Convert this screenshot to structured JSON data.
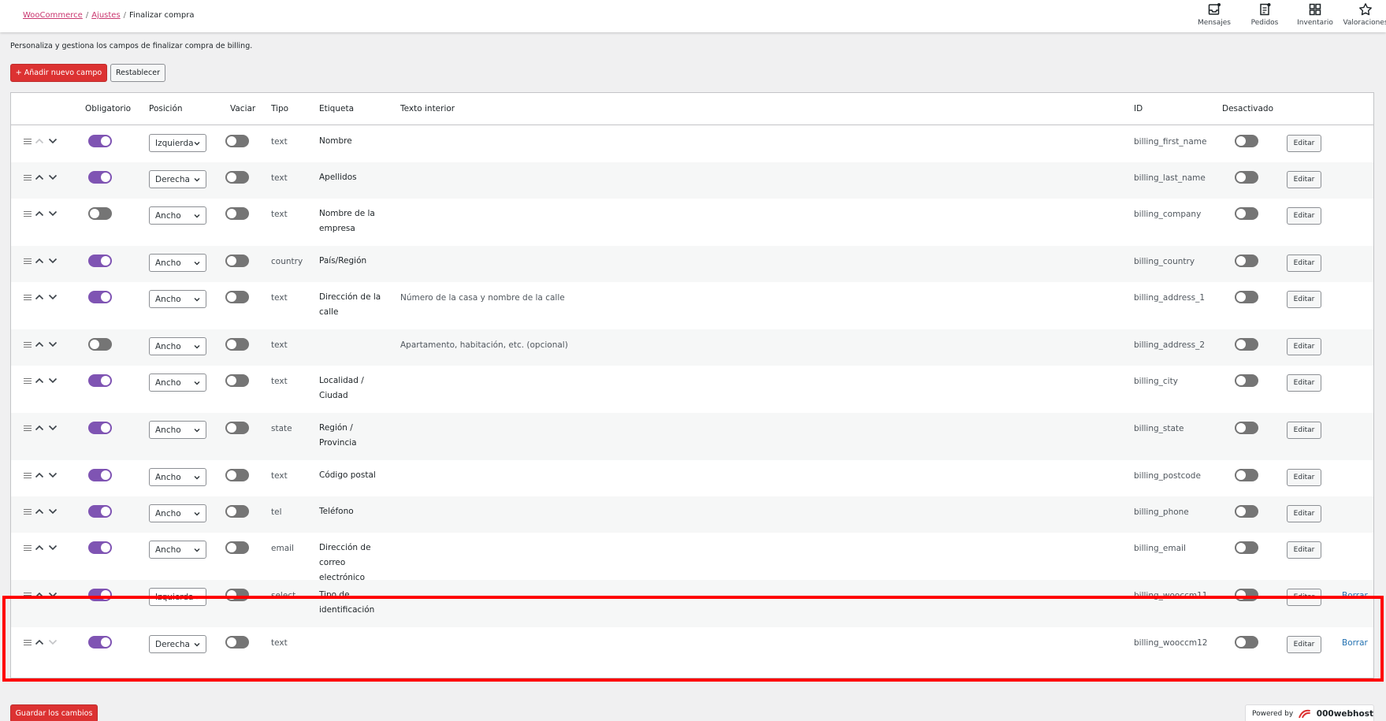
{
  "breadcrumb": {
    "items": [
      "WooCommerce",
      "Ajustes",
      "Finalizar compra"
    ],
    "separator": "/"
  },
  "activity": [
    {
      "label": "Mensajes",
      "icon": "inbox-icon"
    },
    {
      "label": "Pedidos",
      "icon": "orders-icon"
    },
    {
      "label": "Inventario",
      "icon": "inventory-icon"
    },
    {
      "label": "Valoraciones",
      "icon": "star-icon"
    }
  ],
  "description": "Personaliza y gestiona los campos de finalizar compra de billing.",
  "buttons": {
    "add_field": "+ Añadir nuevo campo",
    "reset": "Restablecer",
    "save": "Guardar los cambios"
  },
  "headers": {
    "required": "Obligatorio",
    "position": "Posición",
    "clear": "Vaciar",
    "type": "Tipo",
    "label": "Etiqueta",
    "placeholder": "Texto interior",
    "id": "ID",
    "disabled": "Desactivado"
  },
  "actions": {
    "edit": "Editar",
    "delete": "Borrar"
  },
  "rows": [
    {
      "required": true,
      "position": "Izquierda",
      "clear": false,
      "type": "text",
      "label": "Nombre",
      "placeholder": "",
      "id": "billing_first_name",
      "disabled": false,
      "deletable": false,
      "up": false,
      "down": true
    },
    {
      "required": true,
      "position": "Derecha",
      "clear": false,
      "type": "text",
      "label": "Apellidos",
      "placeholder": "",
      "id": "billing_last_name",
      "disabled": false,
      "deletable": false,
      "up": true,
      "down": true
    },
    {
      "required": false,
      "position": "Ancho",
      "clear": false,
      "type": "text",
      "label": "Nombre de la empresa",
      "placeholder": "",
      "id": "billing_company",
      "disabled": false,
      "deletable": false,
      "up": true,
      "down": true
    },
    {
      "required": true,
      "position": "Ancho",
      "clear": false,
      "type": "country",
      "label": "País/Región",
      "placeholder": "",
      "id": "billing_country",
      "disabled": false,
      "deletable": false,
      "up": true,
      "down": true
    },
    {
      "required": true,
      "position": "Ancho",
      "clear": false,
      "type": "text",
      "label": "Dirección de la calle",
      "placeholder": "Número de la casa y nombre de la calle",
      "id": "billing_address_1",
      "disabled": false,
      "deletable": false,
      "up": true,
      "down": true
    },
    {
      "required": false,
      "position": "Ancho",
      "clear": false,
      "type": "text",
      "label": "",
      "placeholder": "Apartamento, habitación, etc. (opcional)",
      "id": "billing_address_2",
      "disabled": false,
      "deletable": false,
      "up": true,
      "down": true
    },
    {
      "required": true,
      "position": "Ancho",
      "clear": false,
      "type": "text",
      "label": "Localidad / Ciudad",
      "placeholder": "",
      "id": "billing_city",
      "disabled": false,
      "deletable": false,
      "up": true,
      "down": true
    },
    {
      "required": true,
      "position": "Ancho",
      "clear": false,
      "type": "state",
      "label": "Región / Provincia",
      "placeholder": "",
      "id": "billing_state",
      "disabled": false,
      "deletable": false,
      "up": true,
      "down": true
    },
    {
      "required": true,
      "position": "Ancho",
      "clear": false,
      "type": "text",
      "label": "Código postal",
      "placeholder": "",
      "id": "billing_postcode",
      "disabled": false,
      "deletable": false,
      "up": true,
      "down": true
    },
    {
      "required": true,
      "position": "Ancho",
      "clear": false,
      "type": "tel",
      "label": "Teléfono",
      "placeholder": "",
      "id": "billing_phone",
      "disabled": false,
      "deletable": false,
      "up": true,
      "down": true
    },
    {
      "required": true,
      "position": "Ancho",
      "clear": false,
      "type": "email",
      "label": "Dirección de correo electrónico",
      "placeholder": "",
      "id": "billing_email",
      "disabled": false,
      "deletable": false,
      "up": true,
      "down": true
    },
    {
      "required": true,
      "position": "Izquierda",
      "clear": false,
      "type": "select",
      "label": "Tipo de identificación",
      "placeholder": "",
      "id": "billing_wooccm11",
      "disabled": false,
      "deletable": true,
      "up": true,
      "down": true
    },
    {
      "required": true,
      "position": "Derecha",
      "clear": false,
      "type": "text",
      "label": "",
      "placeholder": "",
      "id": "billing_wooccm12",
      "disabled": false,
      "deletable": true,
      "up": true,
      "down": false
    }
  ],
  "footer": {
    "powered_by": "Powered by",
    "brand": "000webhost"
  },
  "colors": {
    "accent": "#7f54b3",
    "primary_button": "#dc3232",
    "link": "#2271b1",
    "highlight": "#ff0000"
  }
}
